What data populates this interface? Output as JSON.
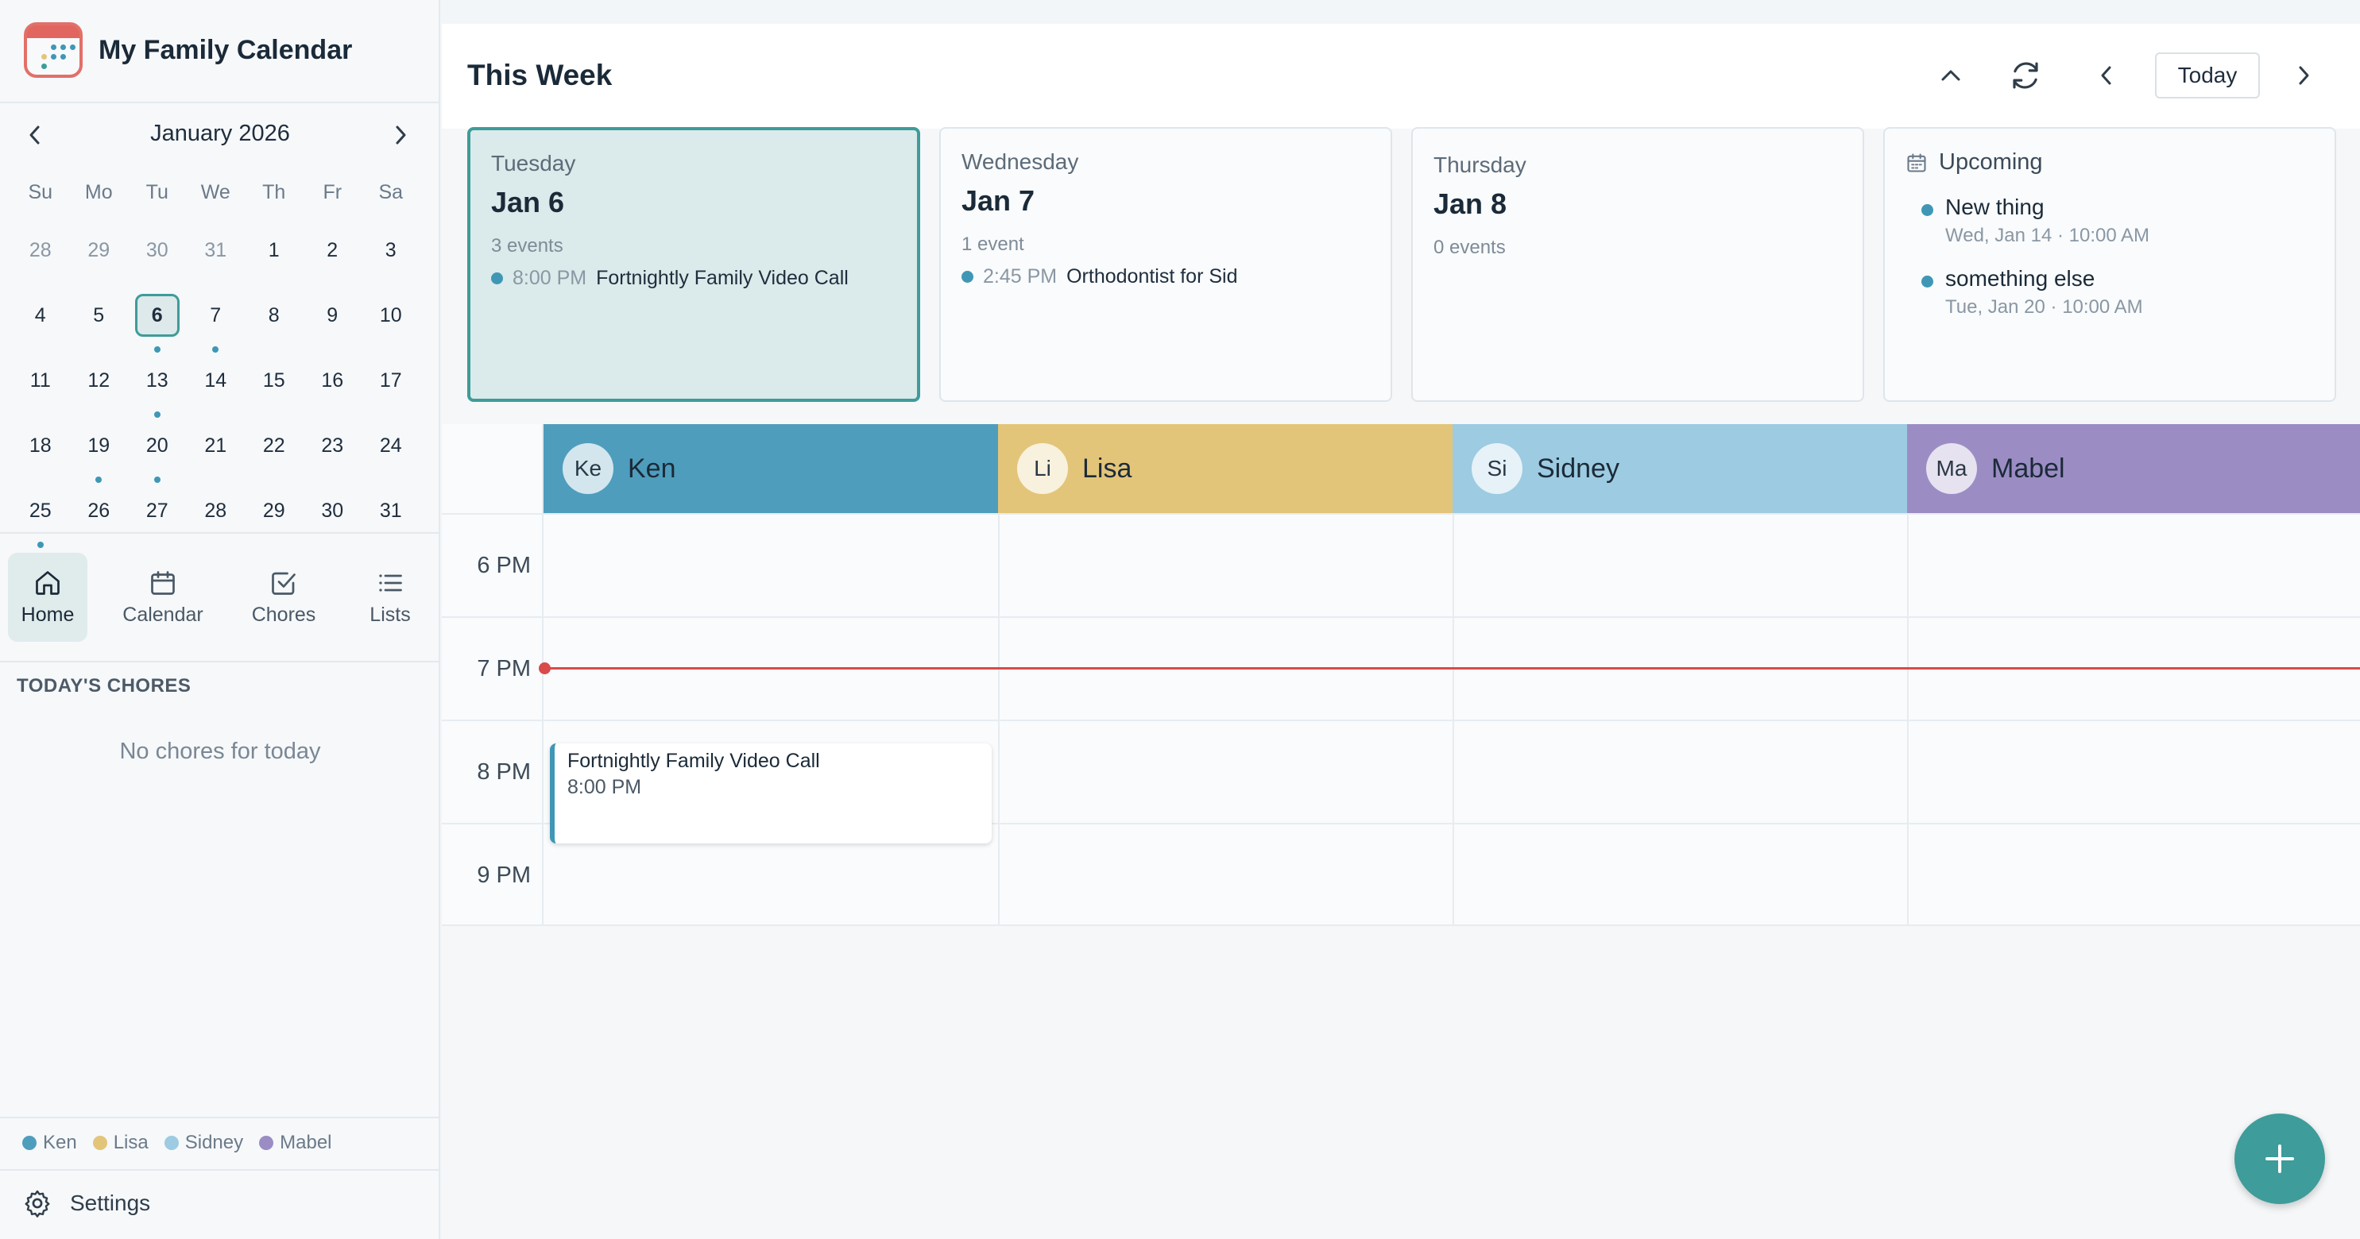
{
  "app": {
    "title": "My Family Calendar"
  },
  "mini_calendar": {
    "month_label": "January 2026",
    "weekdays": [
      "Su",
      "Mo",
      "Tu",
      "We",
      "Th",
      "Fr",
      "Sa"
    ],
    "weeks": [
      [
        {
          "d": "28",
          "o": true
        },
        {
          "d": "29",
          "o": true
        },
        {
          "d": "30",
          "o": true
        },
        {
          "d": "31",
          "o": true
        },
        {
          "d": "1"
        },
        {
          "d": "2"
        },
        {
          "d": "3"
        }
      ],
      [
        {
          "d": "4"
        },
        {
          "d": "5"
        },
        {
          "d": "6",
          "sel": true,
          "dot": true
        },
        {
          "d": "7",
          "dot": true
        },
        {
          "d": "8"
        },
        {
          "d": "9"
        },
        {
          "d": "10"
        }
      ],
      [
        {
          "d": "11"
        },
        {
          "d": "12"
        },
        {
          "d": "13",
          "dot": true
        },
        {
          "d": "14"
        },
        {
          "d": "15"
        },
        {
          "d": "16"
        },
        {
          "d": "17"
        }
      ],
      [
        {
          "d": "18"
        },
        {
          "d": "19",
          "dot": true
        },
        {
          "d": "20",
          "dot": true
        },
        {
          "d": "21"
        },
        {
          "d": "22"
        },
        {
          "d": "23"
        },
        {
          "d": "24"
        }
      ],
      [
        {
          "d": "25",
          "dot": true
        },
        {
          "d": "26"
        },
        {
          "d": "27"
        },
        {
          "d": "28"
        },
        {
          "d": "29"
        },
        {
          "d": "30"
        },
        {
          "d": "31"
        }
      ]
    ]
  },
  "nav": {
    "home": "Home",
    "calendar": "Calendar",
    "chores": "Chores",
    "lists": "Lists"
  },
  "chores": {
    "heading": "TODAY'S CHORES",
    "empty": "No chores for today"
  },
  "legend": [
    {
      "name": "Ken",
      "color": "#4f9dbd"
    },
    {
      "name": "Lisa",
      "color": "#e3c57a"
    },
    {
      "name": "Sidney",
      "color": "#9ccbe2"
    },
    {
      "name": "Mabel",
      "color": "#9b8dc4"
    }
  ],
  "settings": {
    "label": "Settings"
  },
  "main": {
    "title": "This Week",
    "today_label": "Today"
  },
  "days": [
    {
      "dow": "Tuesday",
      "date": "Jan 6",
      "count": "3 events",
      "event_time": "8:00 PM",
      "event_name": "Fortnightly Family Video Call"
    },
    {
      "dow": "Wednesday",
      "date": "Jan 7",
      "count": "1 event",
      "event_time": "2:45 PM",
      "event_name": "Orthodontist for Sid"
    },
    {
      "dow": "Thursday",
      "date": "Jan 8",
      "count": "0 events"
    }
  ],
  "upcoming": {
    "heading": "Upcoming",
    "items": [
      {
        "name": "New thing",
        "meta": "Wed, Jan 14 · 10:00 AM"
      },
      {
        "name": "something else",
        "meta": "Tue, Jan 20 · 10:00 AM"
      }
    ]
  },
  "people": [
    {
      "initials": "Ke",
      "name": "Ken",
      "color": "#4f9dbd"
    },
    {
      "initials": "Li",
      "name": "Lisa",
      "color": "#e3c57a"
    },
    {
      "initials": "Si",
      "name": "Sidney",
      "color": "#9ccbe2"
    },
    {
      "initials": "Ma",
      "name": "Mabel",
      "color": "#9b8dc4"
    }
  ],
  "hours": [
    "6 PM",
    "7 PM",
    "8 PM",
    "9 PM"
  ],
  "grid_event": {
    "name": "Fortnightly Family Video Call",
    "time": "8:00 PM"
  },
  "colors": {
    "accent": "#3e9c9a",
    "now_line": "#d94a4a",
    "event_dot": "#3f97b5"
  }
}
